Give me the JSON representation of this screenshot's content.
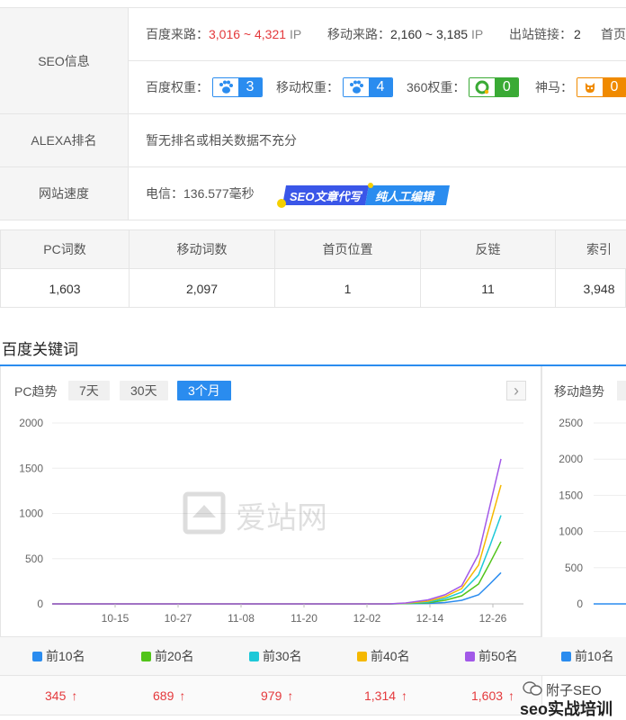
{
  "seo_info": {
    "label": "SEO信息",
    "baidu_source_label": "百度来路：",
    "baidu_source_value": "3,016 ~ 4,321",
    "baidu_source_unit": "IP",
    "mobile_source_label": "移动来路：",
    "mobile_source_value": "2,160 ~ 3,185",
    "mobile_source_unit": "IP",
    "outlinks_label": "出站链接：",
    "outlinks_value": "2",
    "home_label": "首页",
    "baidu_weight_label": "百度权重：",
    "baidu_weight_value": "3",
    "mobile_weight_label": "移动权重：",
    "mobile_weight_value": "4",
    "weight360_label": "360权重：",
    "weight360_value": "0",
    "shenma_label": "神马：",
    "shenma_value": "0"
  },
  "alexa": {
    "label": "ALEXA排名",
    "value": "暂无排名或相关数据不充分"
  },
  "speed": {
    "label": "网站速度",
    "value": "电信：136.577毫秒",
    "ad_left": "SEO文章代写",
    "ad_right": "纯人工编辑"
  },
  "stats": {
    "headers": [
      "PC词数",
      "移动词数",
      "首页位置",
      "反链",
      "索引"
    ],
    "values": [
      "1,603",
      "2,097",
      "1",
      "11",
      "3,948"
    ]
  },
  "section_title": "百度关键词",
  "pc_panel": {
    "title": "PC趋势",
    "tabs": [
      "7天",
      "30天",
      "3个月"
    ],
    "active_tab": "3个月",
    "next_label": "›",
    "watermark": "爱站网"
  },
  "mobile_panel": {
    "title": "移动趋势",
    "legend_first": "前10名"
  },
  "legend": [
    {
      "name": "前10名",
      "color": "#2a8cef",
      "value": "345"
    },
    {
      "name": "前20名",
      "color": "#52c41a",
      "value": "689"
    },
    {
      "name": "前30名",
      "color": "#1ec8d8",
      "value": "979"
    },
    {
      "name": "前40名",
      "color": "#f5b800",
      "value": "1,314"
    },
    {
      "name": "前50名",
      "color": "#a259e8",
      "value": "1,603"
    }
  ],
  "watermark_bottom": {
    "line1": "附子SEO",
    "line2": "seo实战培训"
  },
  "chart_data": [
    {
      "type": "line",
      "title": "PC趋势",
      "categories": [
        "10-15",
        "10-27",
        "11-08",
        "11-20",
        "12-02",
        "12-14",
        "12-26"
      ],
      "ylim": [
        0,
        2000
      ],
      "yticks": [
        "0",
        "500",
        "1000",
        "1500",
        "2000"
      ],
      "grid": true,
      "series": [
        {
          "name": "前10名",
          "color": "#2a8cef",
          "x": [
            0,
            60,
            63,
            67,
            70,
            73,
            76,
            78,
            80
          ],
          "values": [
            0,
            0,
            2,
            5,
            15,
            40,
            100,
            220,
            345
          ]
        },
        {
          "name": "前20名",
          "color": "#52c41a",
          "x": [
            0,
            60,
            63,
            67,
            70,
            73,
            76,
            78,
            80
          ],
          "values": [
            0,
            0,
            4,
            12,
            40,
            90,
            220,
            450,
            689
          ]
        },
        {
          "name": "前30名",
          "color": "#1ec8d8",
          "x": [
            0,
            60,
            63,
            67,
            70,
            73,
            76,
            78,
            80
          ],
          "values": [
            0,
            0,
            6,
            20,
            60,
            130,
            320,
            640,
            979
          ]
        },
        {
          "name": "前40名",
          "color": "#f5b800",
          "x": [
            0,
            60,
            63,
            67,
            70,
            73,
            76,
            78,
            80
          ],
          "values": [
            0,
            0,
            8,
            30,
            80,
            170,
            430,
            870,
            1314
          ]
        },
        {
          "name": "前50名",
          "color": "#a259e8",
          "x": [
            0,
            60,
            63,
            67,
            70,
            73,
            76,
            78,
            80
          ],
          "values": [
            0,
            0,
            10,
            45,
            100,
            200,
            550,
            1080,
            1603
          ]
        }
      ]
    },
    {
      "type": "line",
      "title": "移动趋势",
      "ylim": [
        0,
        2500
      ],
      "yticks": [
        "0",
        "500",
        "1000",
        "1500",
        "2000",
        "2500"
      ],
      "grid": true,
      "series": [
        {
          "name": "前10名",
          "color": "#2a8cef",
          "values": [
            0,
            0
          ]
        }
      ]
    }
  ]
}
